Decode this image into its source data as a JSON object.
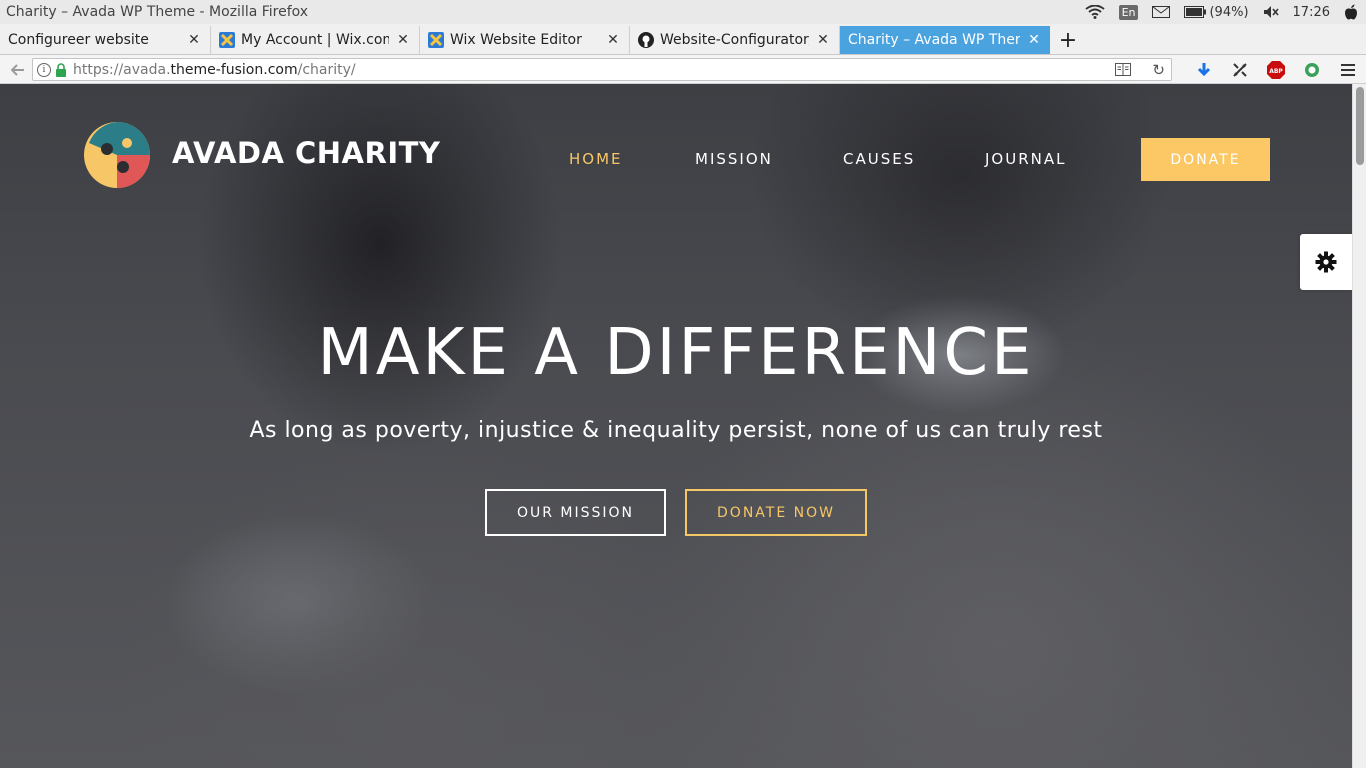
{
  "os": {
    "window_title": "Charity – Avada WP Theme - Mozilla Firefox",
    "lang": "En",
    "battery": "(94%)",
    "clock": "17:26"
  },
  "tabs": [
    {
      "label": "Configureer website",
      "icon": "none"
    },
    {
      "label": "My Account | Wix.com",
      "icon": "wix-icon"
    },
    {
      "label": "Wix Website Editor",
      "icon": "wix-icon"
    },
    {
      "label": "Website-Configurator/s",
      "icon": "github-icon"
    },
    {
      "label": "Charity – Avada WP Them",
      "icon": "none",
      "active": true
    }
  ],
  "browser": {
    "url_prefix": "https://avada.",
    "url_domain": "theme-fusion.com",
    "url_path": "/charity/"
  },
  "site": {
    "name": "AVADA CHARITY",
    "nav": [
      "HOME",
      "MISSION",
      "CAUSES",
      "JOURNAL"
    ],
    "active_nav": "HOME",
    "donate_label": "DONATE",
    "hero_title": "MAKE A DIFFERENCE",
    "hero_subtitle": "As long as poverty, injustice & inequality persist, none of us can truly rest",
    "cta_primary": "OUR MISSION",
    "cta_secondary": "DONATE NOW",
    "accent_color": "#f6c766",
    "button_color": "#fcc866"
  }
}
